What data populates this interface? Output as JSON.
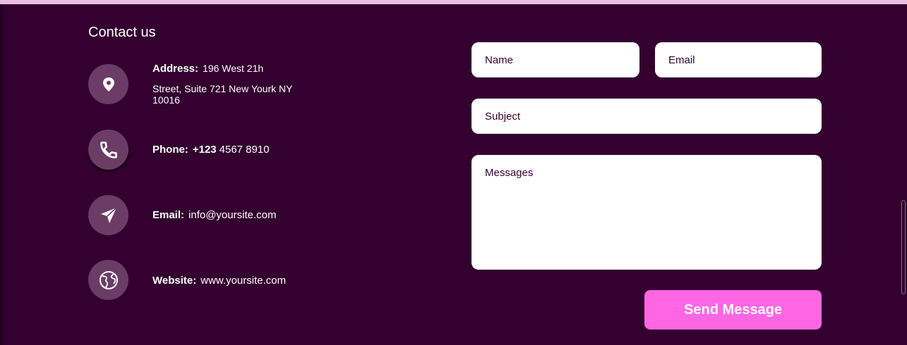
{
  "contact": {
    "title": "Contact us",
    "address": {
      "label": "Address:",
      "line1": "196 West 21h",
      "line2": "Street, Suite 721 New Yourk NY 10016",
      "icon": "location-pin-icon"
    },
    "phone": {
      "label": "Phone:",
      "prefix": "+123",
      "number": "4567 8910",
      "icon": "phone-icon"
    },
    "email": {
      "label": "Email:",
      "value": "info@yoursite.com",
      "icon": "paper-plane-icon"
    },
    "website": {
      "label": "Website:",
      "value": "www.yoursite.com",
      "icon": "globe-icon"
    }
  },
  "form": {
    "name_placeholder": "Name",
    "email_placeholder": "Email",
    "subject_placeholder": "Subject",
    "message_placeholder": "Messages",
    "send_label": "Send Message"
  },
  "colors": {
    "background": "#330030",
    "icon_circle": "#6b3c66",
    "accent": "#ff66e3",
    "top_bar": "#e9bfe3"
  }
}
